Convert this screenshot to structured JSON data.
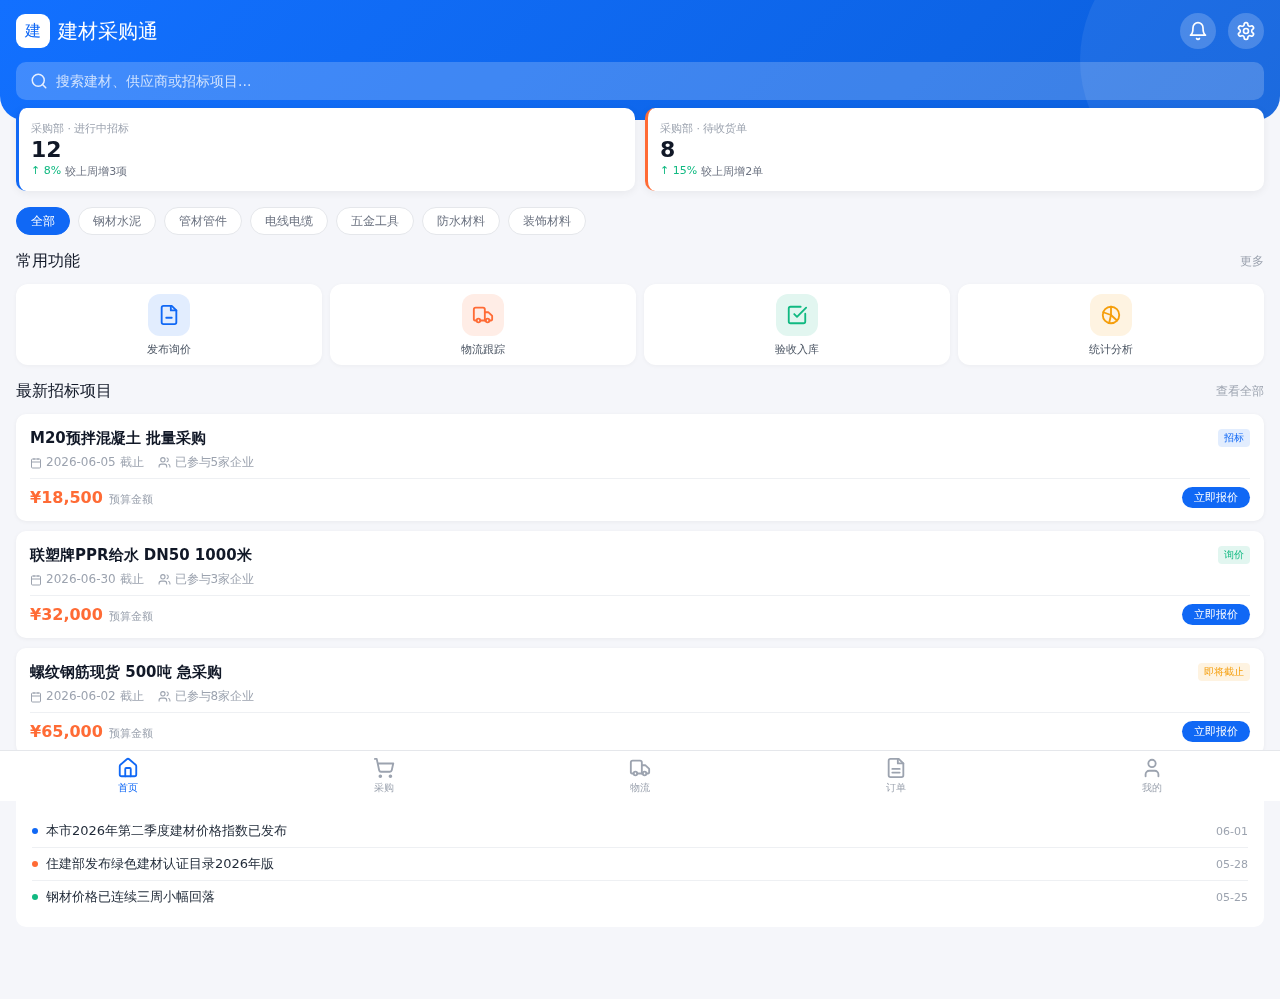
{
  "header": {
    "logo": "建",
    "title": "建材采购通",
    "search": {
      "placeholder": "搜索建材、供应商或招标项目..."
    }
  },
  "stats": [
    {
      "label": "采购部 · 进行中招标",
      "value": "12",
      "delta": "↑ 8%",
      "note": "较上周增3项",
      "color": "#1068f5"
    },
    {
      "label": "采购部 · 待收货单",
      "value": "8",
      "delta": "↑ 15%",
      "note": "较上周增2单",
      "color": "#ff6b35"
    }
  ],
  "categories": [
    {
      "label": "全部",
      "selected": true
    },
    {
      "label": "钢材水泥",
      "selected": false
    },
    {
      "label": "管材管件",
      "selected": false
    },
    {
      "label": "电线电缆",
      "selected": false
    },
    {
      "label": "五金工具",
      "selected": false
    },
    {
      "label": "防水材料",
      "selected": false
    },
    {
      "label": "装饰材料",
      "selected": false
    }
  ],
  "quick_section": {
    "title": "常用功能",
    "more": "更多"
  },
  "quick_actions": [
    {
      "kind": "file",
      "label": "发布询价",
      "color": "#1068f5"
    },
    {
      "kind": "truck",
      "label": "物流跟踪",
      "color": "#ff6b35"
    },
    {
      "kind": "check",
      "label": "验收入库",
      "color": "#10b981"
    },
    {
      "kind": "chart",
      "label": "统计分析",
      "color": "#f59e0b"
    }
  ],
  "tender_section": {
    "title": "最新招标项目",
    "more": "查看全部"
  },
  "tenders": [
    {
      "title": "M20预拌混凝土 批量采购",
      "tag": {
        "label": "招标",
        "kind": "bid"
      },
      "deadline": "2026-06-05 截止",
      "bidders": "已参与5家企业",
      "price": "¥18,500",
      "price_label": "预算金额",
      "action": "立即报价"
    },
    {
      "title": "联塑牌PPR给水 DN50 1000米",
      "tag": {
        "label": "询价",
        "kind": "inquiry"
      },
      "deadline": "2026-06-30 截止",
      "bidders": "已参与3家企业",
      "price": "¥32,000",
      "price_label": "预算金额",
      "action": "立即报价"
    },
    {
      "title": "螺纹钢筋现货 500吨 急采购",
      "tag": {
        "label": "即将截止",
        "kind": "closing"
      },
      "deadline": "2026-06-02 截止",
      "bidders": "已参与8家企业",
      "price": "¥65,000",
      "price_label": "预算金额",
      "action": "立即报价"
    }
  ],
  "news": {
    "items": [
      {
        "text": "本市2026年第二季度建材价格指数已发布",
        "date": "06-01",
        "color": "#1068f5"
      },
      {
        "text": "住建部发布绿色建材认证目录2026年版",
        "date": "05-28",
        "color": "#ff6b35"
      },
      {
        "text": "钢材价格已连续三周小幅回落",
        "date": "05-25",
        "color": "#10b981"
      }
    ]
  },
  "bottom_nav": [
    {
      "kind": "home",
      "label": "首页",
      "selected": true
    },
    {
      "kind": "cart",
      "label": "采购",
      "selected": false
    },
    {
      "kind": "truck",
      "label": "物流",
      "selected": false
    },
    {
      "kind": "file",
      "label": "订单",
      "selected": false
    },
    {
      "kind": "user",
      "label": "我的",
      "selected": false
    }
  ]
}
